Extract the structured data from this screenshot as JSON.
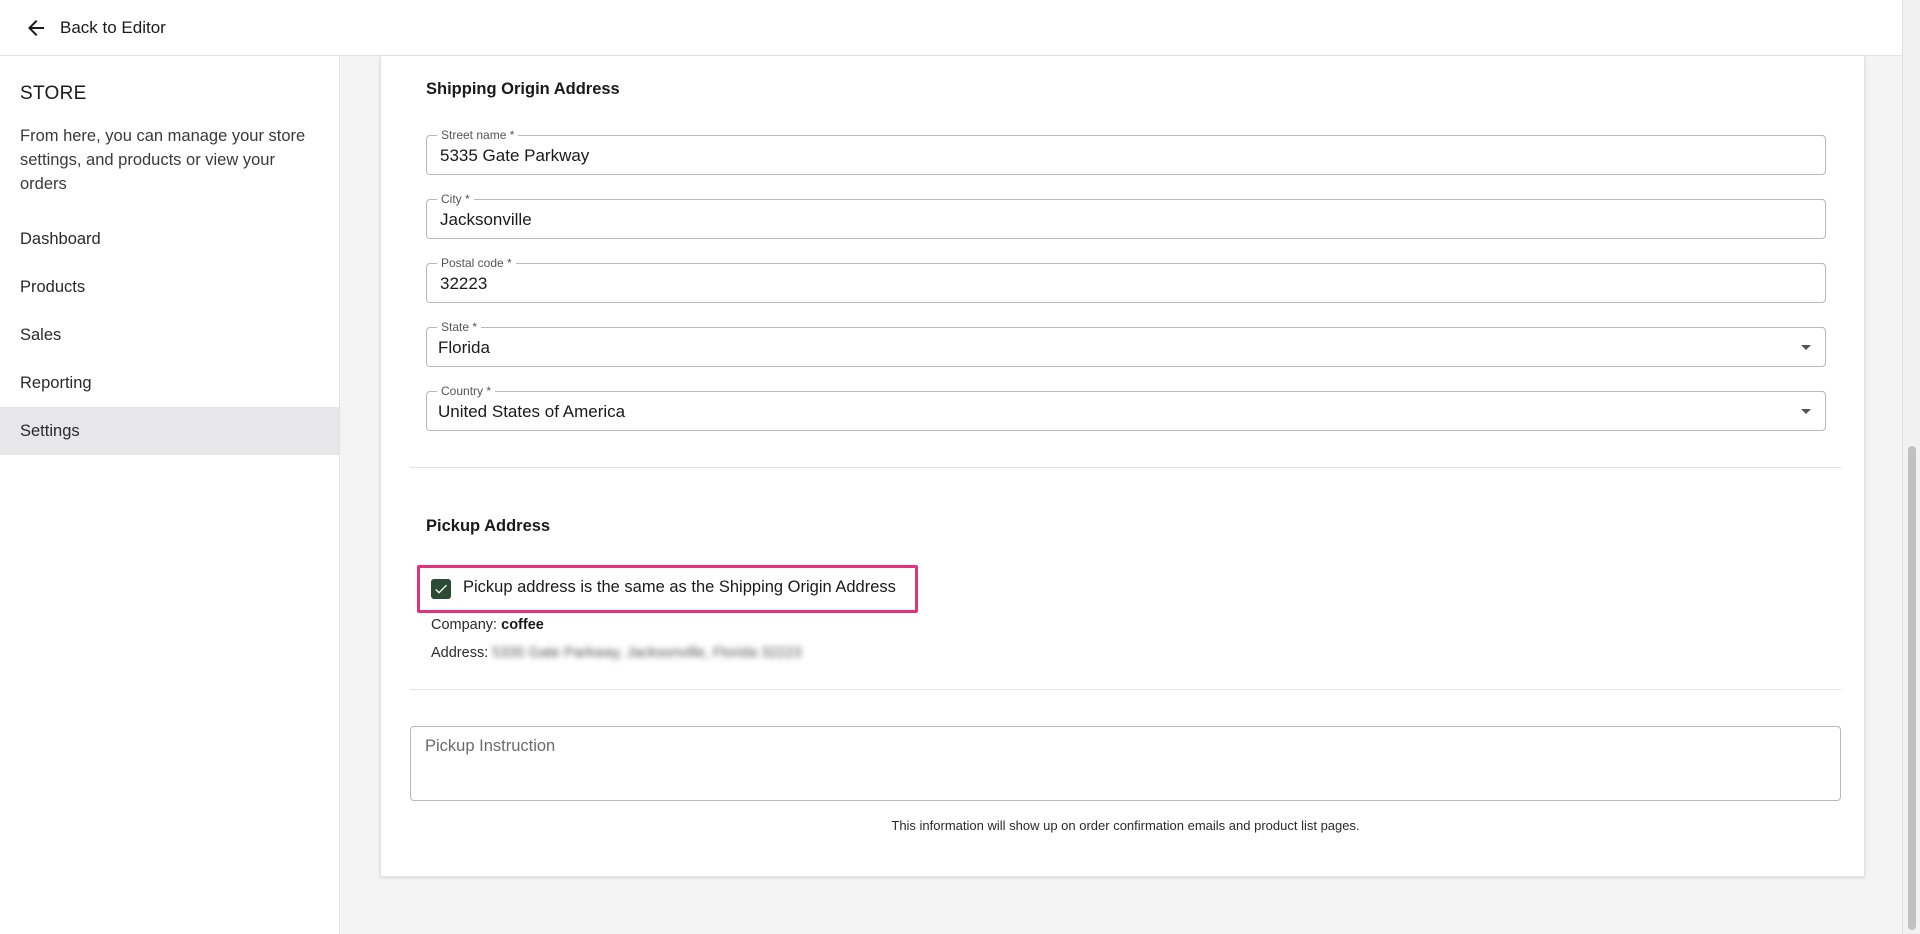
{
  "topbar": {
    "back_label": "Back to Editor"
  },
  "sidebar": {
    "title": "STORE",
    "description": "From here, you can manage your store settings, and products or view your orders",
    "items": [
      {
        "label": "Dashboard"
      },
      {
        "label": "Products"
      },
      {
        "label": "Sales"
      },
      {
        "label": "Reporting"
      },
      {
        "label": "Settings",
        "active": true
      }
    ]
  },
  "shipping_origin": {
    "title": "Shipping Origin Address",
    "street": {
      "label": "Street name *",
      "value": "5335 Gate Parkway"
    },
    "city": {
      "label": "City *",
      "value": "Jacksonville"
    },
    "postal": {
      "label": "Postal code *",
      "value": "32223"
    },
    "state": {
      "label": "State *",
      "value": "Florida"
    },
    "country": {
      "label": "Country *",
      "value": "United States of America"
    }
  },
  "pickup": {
    "title": "Pickup Address",
    "same_as_label": "Pickup address is the same as the Shipping Origin Address",
    "same_as_checked": true,
    "company_label": "Company:",
    "company_value": "coffee",
    "address_label": "Address:",
    "address_value": "5335 Gate Parkway, Jacksonville, Florida 32223"
  },
  "instruction": {
    "placeholder": "Pickup Instruction",
    "helper": "This information will show up on order confirmation emails and product list pages."
  },
  "colors": {
    "accent_checkbox": "#2d4a35",
    "highlight_border": "#e6317a",
    "active_nav_bg": "#e7e7ea"
  }
}
